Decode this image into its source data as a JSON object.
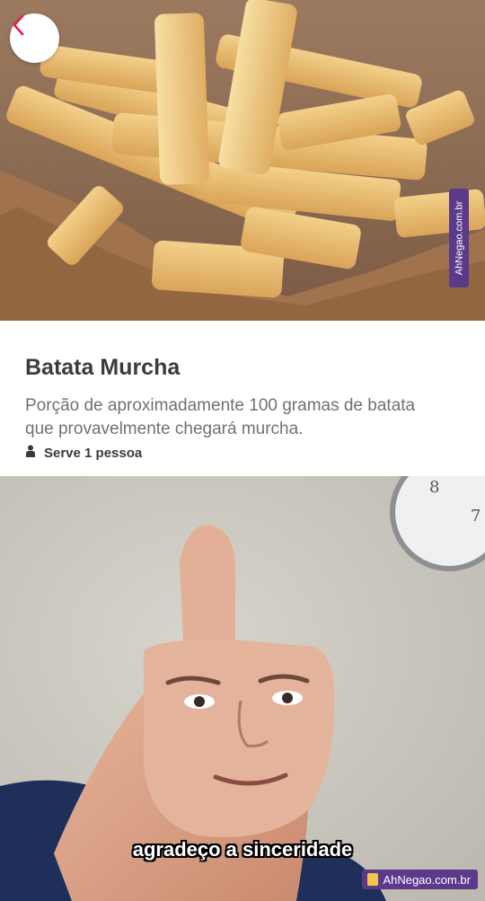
{
  "header": {
    "back_icon": "chevron-left-icon",
    "accent_color": "#e0214a"
  },
  "product": {
    "image": "french-fries-photo",
    "watermark": "AhNegao.com.br",
    "title": "Batata Murcha",
    "description": "Porção de aproximadamente 100 gramas de batata que provavelmente chegará murcha.",
    "serves_icon": "person-icon",
    "serves": "Serve 1 pessoa"
  },
  "meme": {
    "image": "thumbs-up-face-meme",
    "clock_numbers": [
      "8",
      "7"
    ],
    "caption": "agradeço a sinceridade",
    "watermark": "AhNegao.com.br"
  }
}
